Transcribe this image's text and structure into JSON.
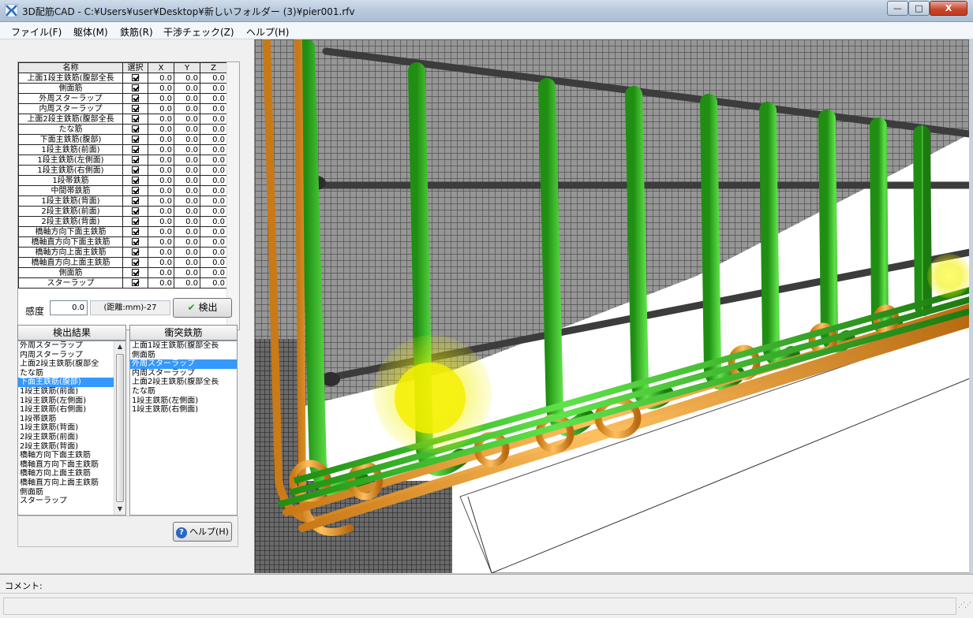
{
  "window": {
    "title": "3D配筋CAD - C:¥Users¥user¥Desktop¥新しいフォルダー (3)¥pier001.rfv",
    "minimize_icon": "minimize-icon",
    "maximize_icon": "maximize-icon",
    "close_icon": "close-icon",
    "min_label": "—",
    "max_label": "□",
    "close_label": "X"
  },
  "menu": [
    {
      "label": "ファイル(F)"
    },
    {
      "label": "躯体(M)"
    },
    {
      "label": "鉄筋(R)"
    },
    {
      "label": "干渉チェック(Z)"
    },
    {
      "label": "ヘルプ(H)"
    }
  ],
  "table": {
    "headers": {
      "name": "名称",
      "select": "選択",
      "x": "X",
      "y": "Y",
      "z": "Z"
    },
    "rows": [
      {
        "name": "上面1段主鉄筋(腹部全長",
        "x": "0.0",
        "y": "0.0",
        "z": "0.0"
      },
      {
        "name": "側面筋",
        "x": "0.0",
        "y": "0.0",
        "z": "0.0"
      },
      {
        "name": "外周スターラップ",
        "x": "0.0",
        "y": "0.0",
        "z": "0.0"
      },
      {
        "name": "内周スターラップ",
        "x": "0.0",
        "y": "0.0",
        "z": "0.0"
      },
      {
        "name": "上面2段主鉄筋(腹部全長",
        "x": "0.0",
        "y": "0.0",
        "z": "0.0"
      },
      {
        "name": "たな筋",
        "x": "0.0",
        "y": "0.0",
        "z": "0.0"
      },
      {
        "name": "下面主鉄筋(腹部)",
        "x": "0.0",
        "y": "0.0",
        "z": "0.0"
      },
      {
        "name": "1段主鉄筋(前面)",
        "x": "0.0",
        "y": "0.0",
        "z": "0.0"
      },
      {
        "name": "1段主鉄筋(左側面)",
        "x": "0.0",
        "y": "0.0",
        "z": "0.0"
      },
      {
        "name": "1段主鉄筋(右側面)",
        "x": "0.0",
        "y": "0.0",
        "z": "0.0"
      },
      {
        "name": "1段帯鉄筋",
        "x": "0.0",
        "y": "0.0",
        "z": "0.0"
      },
      {
        "name": "中間帯鉄筋",
        "x": "0.0",
        "y": "0.0",
        "z": "0.0"
      },
      {
        "name": "1段主鉄筋(背面)",
        "x": "0.0",
        "y": "0.0",
        "z": "0.0"
      },
      {
        "name": "2段主鉄筋(前面)",
        "x": "0.0",
        "y": "0.0",
        "z": "0.0"
      },
      {
        "name": "2段主鉄筋(背面)",
        "x": "0.0",
        "y": "0.0",
        "z": "0.0"
      },
      {
        "name": "橋軸方向下面主鉄筋",
        "x": "0.0",
        "y": "0.0",
        "z": "0.0"
      },
      {
        "name": "橋軸直方向下面主鉄筋",
        "x": "0.0",
        "y": "0.0",
        "z": "0.0"
      },
      {
        "name": "橋軸方向上面主鉄筋",
        "x": "0.0",
        "y": "0.0",
        "z": "0.0"
      },
      {
        "name": "橋軸直方向上面主鉄筋",
        "x": "0.0",
        "y": "0.0",
        "z": "0.0"
      },
      {
        "name": "側面筋",
        "x": "0.0",
        "y": "0.0",
        "z": "0.0"
      },
      {
        "name": "スターラップ",
        "x": "0.0",
        "y": "0.0",
        "z": "0.0"
      }
    ]
  },
  "controls": {
    "sensitivity_label": "感度",
    "sensitivity_value": "0.0",
    "distance_label": "(距離:mm)-27",
    "detect_label": "検出",
    "detect_icon": "green-check-icon",
    "help_label": "ヘルプ(H)",
    "help_icon": "question-icon"
  },
  "results": {
    "header": "検出結果",
    "items": [
      "外周スターラップ",
      "内周スターラップ",
      "上面2段主鉄筋(腹部全",
      "たな筋",
      "下面主鉄筋(腹部)",
      "1段主鉄筋(前面)",
      "1段主鉄筋(左側面)",
      "1段主鉄筋(右側面)",
      "1段帯鉄筋",
      "1段主鉄筋(背面)",
      "2段主鉄筋(前面)",
      "2段主鉄筋(背面)",
      "橋軸方向下面主鉄筋",
      "橋軸直方向下面主鉄筋",
      "橋軸方向上面主鉄筋",
      "橋軸直方向上面主鉄筋",
      "側面筋",
      "スターラップ"
    ],
    "selected_index": 4,
    "scroll_up_icon": "scroll-up-icon",
    "scroll_down_icon": "scroll-down-icon"
  },
  "collisions": {
    "header": "衝突鉄筋",
    "items": [
      "上面1段主鉄筋(腹部全長",
      "側面筋",
      "外周スターラップ",
      "内周スターラップ",
      "上面2段主鉄筋(腹部全長",
      "たな筋",
      "1段主鉄筋(左側面)",
      "1段主鉄筋(右側面)"
    ],
    "selected_index": 2
  },
  "status": {
    "comment_label": "コメント:",
    "grip_icon": "resize-grip-icon"
  },
  "colors": {
    "rebar_green": "#3cc828",
    "rebar_orange": "#f0a030",
    "rebar_dark": "#4a4a4a",
    "highlight_yellow": "#f4f000",
    "selection_blue": "#3399ff"
  }
}
